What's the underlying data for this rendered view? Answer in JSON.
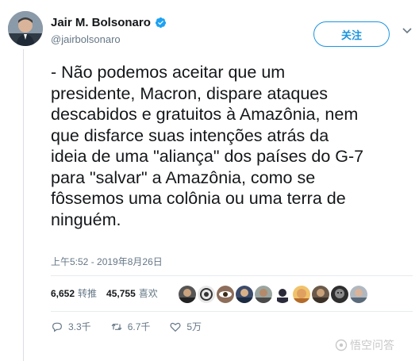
{
  "author": {
    "name": "Jair M. Bolsonaro",
    "handle": "@jairbolsonaro",
    "verified": true
  },
  "follow_label": "关注",
  "tweet": {
    "lines": [
      "- Não podemos aceitar que um",
      "presidente, Macron, dispare ataques",
      "descabidos e gratuitos à Amazônia, nem",
      "que disfarce suas intenções atrás da",
      "ideia de uma \"aliança\" dos países do G-7",
      "para \"salvar\" a Amazônia, como se",
      "fôssemos uma colônia ou uma terra de",
      "ninguém."
    ],
    "timestamp": "上午5:52 - 2019年8月26日"
  },
  "stats": {
    "retweets_count": "6,652",
    "retweets_label": "转推",
    "likes_count": "45,755",
    "likes_label": "喜欢"
  },
  "liker_avatars": [
    "avatar",
    "avatar",
    "avatar",
    "avatar",
    "avatar",
    "avatar",
    "avatar",
    "avatar",
    "avatar",
    "avatar"
  ],
  "actions": {
    "reply_count": "3.3千",
    "retweet_count": "6.7千",
    "like_count": "5万"
  },
  "watermark": "悟空问答",
  "colors": {
    "accent": "#1b95e0",
    "muted": "#657786",
    "divider": "#e6ecf0"
  }
}
